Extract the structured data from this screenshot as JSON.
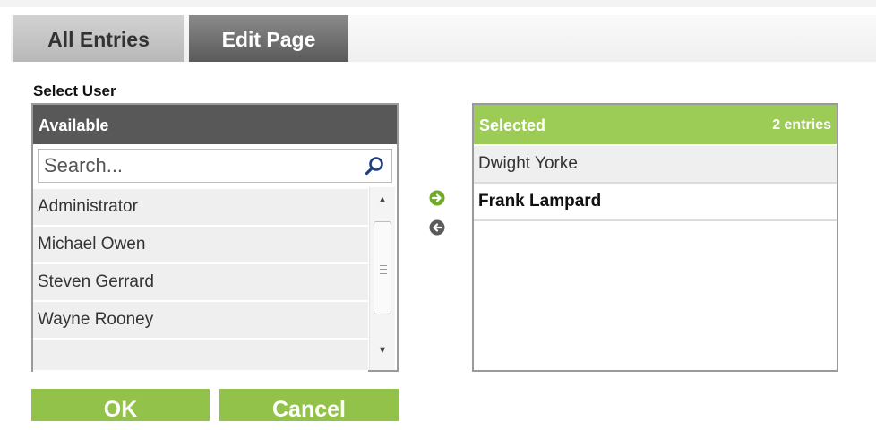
{
  "tabs": [
    {
      "label": "All Entries",
      "state": "inactive"
    },
    {
      "label": "Edit Page",
      "state": "active"
    }
  ],
  "section_label": "Select User",
  "available": {
    "header": "Available",
    "search_placeholder": "Search...",
    "items": [
      "Administrator",
      "Michael Owen",
      "Steven Gerrard",
      "Wayne Rooney"
    ]
  },
  "selected": {
    "header": "Selected",
    "count_label": "2 entries",
    "items": [
      "Dwight Yorke",
      "Frank Lampard"
    ]
  },
  "buttons": {
    "ok": "OK",
    "cancel": "Cancel"
  },
  "colors": {
    "green": "#9ccc55",
    "dark_header": "#585858",
    "button_green": "#93c24a"
  },
  "icons": {
    "search": "search-icon",
    "add": "arrow-right-circle-icon",
    "remove": "arrow-left-circle-icon"
  }
}
